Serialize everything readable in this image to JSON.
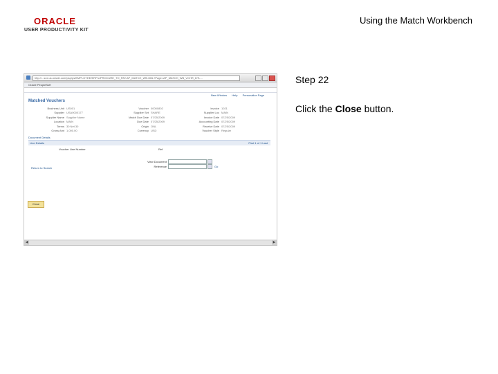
{
  "header": {
    "logo_text": "ORACLE",
    "logo_sub": "USER PRODUCTIVITY KIT",
    "title": "Using the Match Workbench"
  },
  "step": {
    "number": "Step 22",
    "instruction_prefix": "Click the ",
    "instruction_bold": "Close",
    "instruction_suffix": " button."
  },
  "screenshot": {
    "address": "http://...sxx.us.oracle.com/psp/ps/EMPLOYEE/ERP/c/PROCURE_TO_PAY.AP_MATCH_WB.GBL?Page=AP_MATCH_WB_VCHR_DTL...",
    "favorite": "Oracle PeopleSoft",
    "top_links": [
      "New Window",
      "Help",
      "Personalize Page"
    ],
    "page_heading": "Matched Vouchers",
    "fields_col1": [
      {
        "label": "Business Unit",
        "value": "US001"
      },
      {
        "label": "Supplier",
        "value": "USA0000177"
      },
      {
        "label": "Supplier Name",
        "value": "Supplier Name"
      },
      {
        "label": "Location",
        "value": "MAIN"
      },
      {
        "label": "Terms",
        "value": "30 Net 30"
      },
      {
        "label": "Gross Amt",
        "value": "1,000.00"
      }
    ],
    "fields_col2": [
      {
        "label": "Voucher",
        "value": "00000802"
      },
      {
        "label": "Supplier Set",
        "value": "SHARE"
      },
      {
        "label": "Match Due Date",
        "value": "07/25/2009"
      },
      {
        "label": "Due Date",
        "value": "07/25/2009"
      },
      {
        "label": "Origin",
        "value": "ONL"
      },
      {
        "label": "Currency",
        "value": "USD"
      }
    ],
    "fields_col3": [
      {
        "label": "Invoice",
        "value": "1021"
      },
      {
        "label": "Supplier Loc",
        "value": "MAIN"
      },
      {
        "label": "Invoice Date",
        "value": "07/25/2009"
      },
      {
        "label": "Accounting Date",
        "value": "07/25/2009"
      },
      {
        "label": "Receive Date",
        "value": "07/25/2009"
      },
      {
        "label": "Voucher Style",
        "value": "Regular"
      }
    ],
    "doc_details": "Document Details",
    "grid_link": "Line Details",
    "grid_nav": "First  1 of 1  Last",
    "col_voucher_line": "Voucher Line Number",
    "col_ref": "Ref",
    "view_document_label": "View Document",
    "ref_label": "Reference",
    "go_label": "Go",
    "return_link": "Return to Search",
    "close_button": "Close"
  }
}
